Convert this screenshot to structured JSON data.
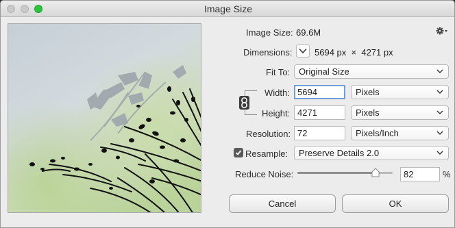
{
  "window": {
    "title": "Image Size"
  },
  "image_size": {
    "label": "Image Size:",
    "value": "69.6M"
  },
  "dimensions": {
    "label": "Dimensions:",
    "width_value": "5694",
    "width_unit": "px",
    "separator": "×",
    "height_value": "4271",
    "height_unit": "px"
  },
  "fit_to": {
    "label": "Fit To:",
    "selected": "Original Size"
  },
  "width": {
    "label": "Width:",
    "value": "5694",
    "unit": "Pixels"
  },
  "height": {
    "label": "Height:",
    "value": "4271",
    "unit": "Pixels"
  },
  "resolution": {
    "label": "Resolution:",
    "value": "72",
    "unit": "Pixels/Inch"
  },
  "resample": {
    "label": "Resample:",
    "checked": true,
    "selected": "Preserve Details 2.0"
  },
  "reduce_noise": {
    "label": "Reduce Noise:",
    "value": "82",
    "unit": "%",
    "fraction": 0.82
  },
  "buttons": {
    "cancel": "Cancel",
    "ok": "OK"
  },
  "icons": {
    "settings": "gear-icon",
    "link": "chain-link-icon",
    "dimensions_toggle": "chevron-down-icon"
  },
  "colors": {
    "close_button": "#2dc53e",
    "focus_ring": "#6f9fd8"
  }
}
